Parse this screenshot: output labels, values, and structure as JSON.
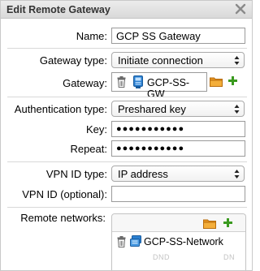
{
  "dialog": {
    "title": "Edit Remote Gateway",
    "close_icon": "close-x-icon"
  },
  "form": {
    "name": {
      "label": "Name:",
      "value": "GCP SS Gateway"
    },
    "gateway_type": {
      "label": "Gateway type:",
      "value": "Initiate connection"
    },
    "gateway": {
      "label": "Gateway:",
      "value": "GCP-SS-GW",
      "icons": [
        "trash-icon",
        "network-host-icon",
        "folder-icon",
        "add-plus-icon"
      ]
    },
    "auth_type": {
      "label": "Authentication type:",
      "value": "Preshared key"
    },
    "key": {
      "label": "Key:",
      "value": "●●●●●●●●●●●"
    },
    "repeat": {
      "label": "Repeat:",
      "value": "●●●●●●●●●●●"
    },
    "vpn_id_type": {
      "label": "VPN ID type:",
      "value": "IP address"
    },
    "vpn_id": {
      "label": "VPN ID (optional):",
      "value": ""
    },
    "remote_networks": {
      "label": "Remote networks:",
      "items": [
        {
          "name": "GCP-SS-Network"
        }
      ],
      "dnd_left": "DND",
      "dnd_right": "DN"
    }
  },
  "colors": {
    "accent_green": "#3a9a1f",
    "folder_orange": "#e8941e",
    "network_blue": "#2a7fd0"
  }
}
